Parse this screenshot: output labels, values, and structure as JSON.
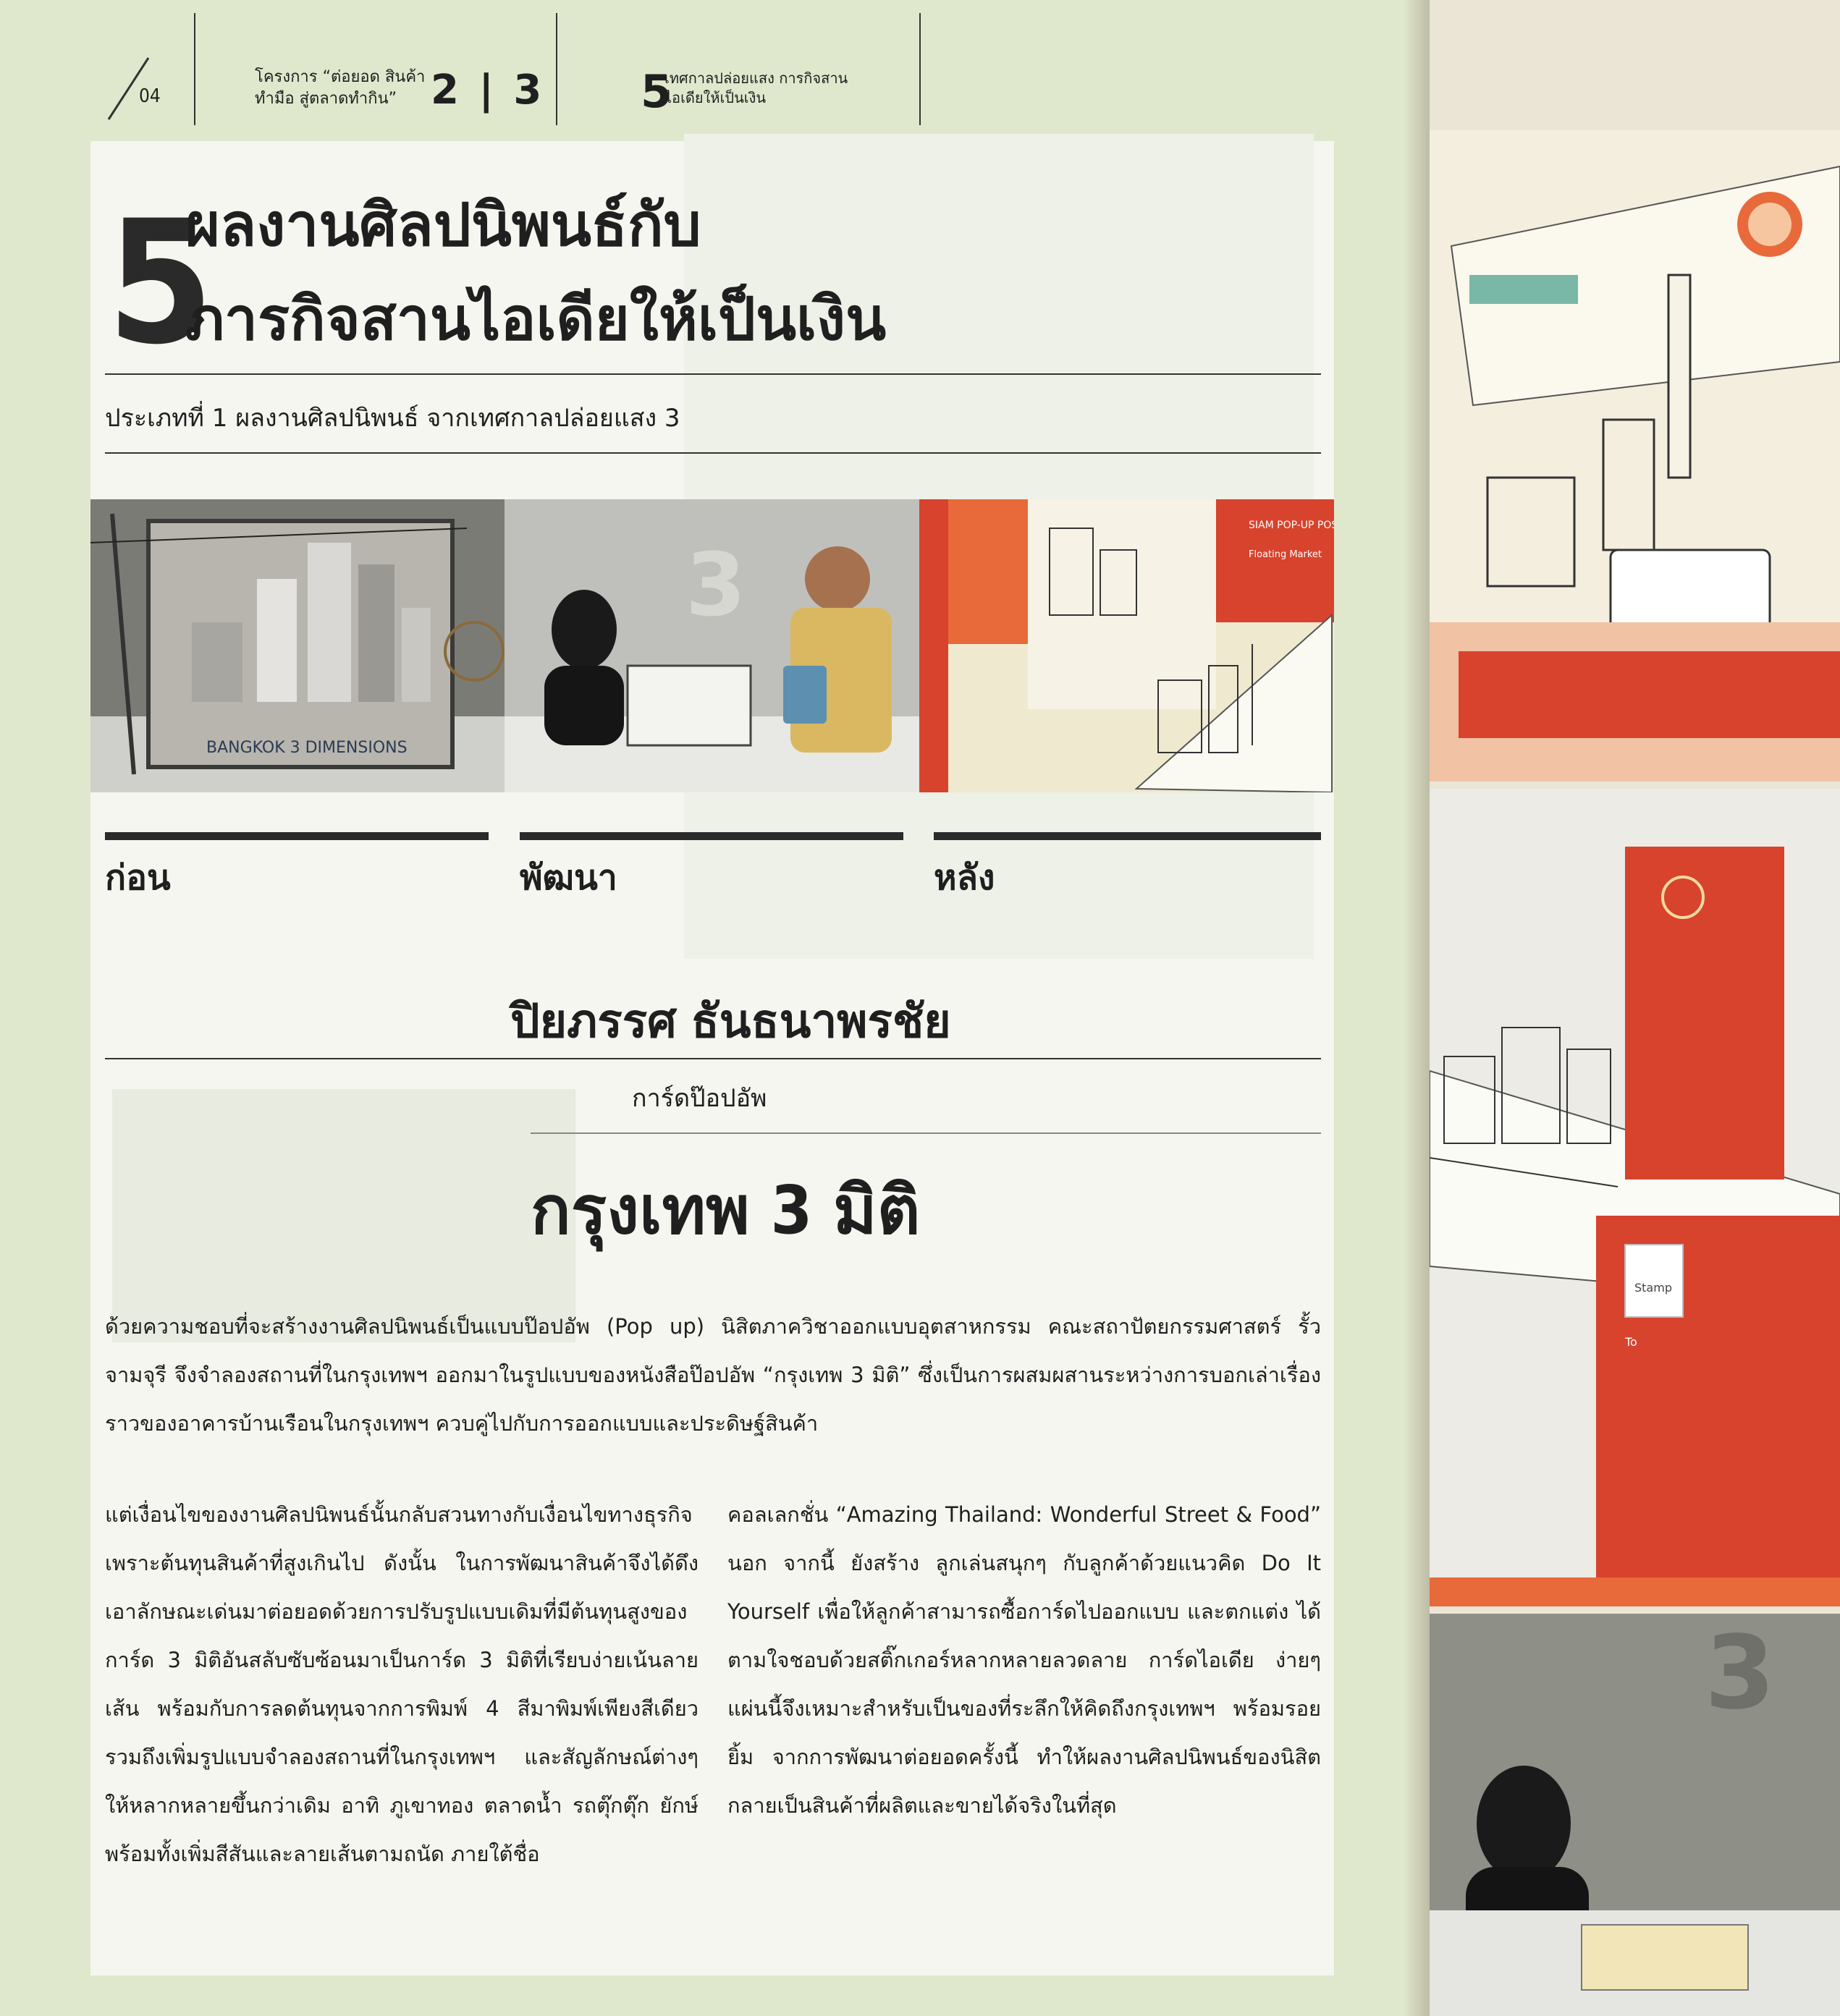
{
  "header": {
    "page_number": "04",
    "program_name": "โครงการ “ต่อยอด สินค้าทำมือ สู่ตลาดทำกิน”",
    "program_index": "2 | 3",
    "festival_number": "5",
    "festival_title": "เทศกาลปล่อยแสง การกิจสานไอเดียให้เป็นเงิน"
  },
  "title": {
    "number": "5",
    "line1": "ผลงานศิลปนิพนธ์กับ",
    "line2": "ภารกิจสานไอเดียให้เป็นเงิน"
  },
  "subtitle": "ประเภทที่ 1 ผลงานศิลปนิพนธ์ จากเทศกาลปล่อยแสง 3",
  "stages": [
    "ก่อน",
    "พัฒนา",
    "หลัง"
  ],
  "author": "ปิยภรรศ ธันธนาพรชัย",
  "card_type": "การ์ดป๊อปอัพ",
  "product_name": "กรุงเทพ 3 มิติ",
  "intro": "ด้วยความชอบที่จะสร้างงานศิลปนิพนธ์เป็นแบบป๊อปอัพ (Pop up) นิสิตภาควิชาออกแบบอุตสาหกรรม คณะสถาปัตยกรรมศาสตร์ รั้วจามจุรี จึงจำลองสถานที่ในกรุงเทพฯ ออกมาในรูปแบบของหนังสือป๊อปอัพ “กรุงเทพ 3 มิติ” ซึ่งเป็นการผสมผสานระหว่างการบอกเล่าเรื่องราวของอาคารบ้านเรือนในกรุงเทพฯ ควบคู่ไปกับการออกแบบและประดิษฐ์สินค้า",
  "body_left": "แต่เงื่อนไขของงานศิลปนิพนธ์นั้นกลับสวนทางกับเงื่อนไขทางธุรกิจเพราะต้นทุนสินค้าที่สูงเกินไป ดังนั้น ในการพัฒนาสินค้าจึงได้ดึงเอาลักษณะเด่นมาต่อยอดด้วยการปรับรูปแบบเดิมที่มีต้นทุนสูงของการ์ด 3 มิติอันสลับซับซ้อนมาเป็นการ์ด 3 มิติที่เรียบง่ายเน้นลายเส้น พร้อมกับการลดต้นทุนจากการพิมพ์ 4 สีมาพิมพ์เพียงสีเดียว รวมถึงเพิ่มรูปแบบจำลองสถานที่ในกรุงเทพฯ และสัญลักษณ์ต่างๆ ให้หลากหลายขึ้นกว่าเดิม อาทิ ภูเขาทอง ตลาดน้ำ รถตุ๊กตุ๊ก ยักษ์ พร้อมทั้งเพิ่มสีสันและลายเส้นตามถนัด ภายใต้ชื่อ",
  "body_right": "คอลเลกชั่น “Amazing Thailand: Wonderful Street & Food” นอก จากนี้ ยังสร้าง ลูกเล่นสนุกๆ กับลูกค้าด้วยแนวคิด Do It Yourself เพื่อให้ลูกค้าสามารถซื้อการ์ดไปออกแบบ และตกแต่ง ได้ตามใจชอบด้วยสติ๊กเกอร์หลากหลายลวดลาย การ์ดไอเดีย ง่ายๆ แผ่นนี้จึงเหมาะสำหรับเป็นของที่ระลึกให้คิดถึงกรุงเทพฯ พร้อมรอยยิ้ม จากการพัฒนาต่อยอดครั้งนี้ ทำให้ผลงานศิลปนิพนธ์ของนิสิตกลายเป็นสินค้าที่ผลิตและขายได้จริงในที่สุด",
  "photo_labels": {
    "before_sign": "BANGKOK 3 DIMENSIONS",
    "after_cover": "SIAM POP-UP POSTCARD",
    "after_sub": "Floating Market",
    "stamp": "Stamp",
    "to": "To",
    "room_number": "3"
  },
  "colors": {
    "page_bg": "#dfe8cc",
    "panel_bg": "#f4f6ef",
    "accent_red": "#d7432d",
    "ink": "#1f1f1f"
  }
}
